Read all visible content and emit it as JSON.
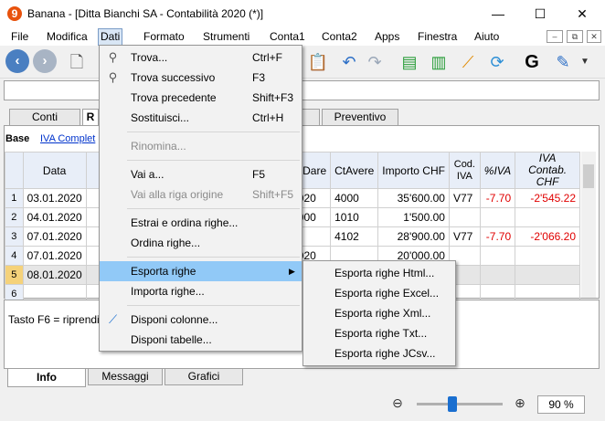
{
  "window": {
    "title": "Banana - [Ditta Bianchi SA - Contabilità 2020 (*)]",
    "minimize": "—",
    "maximize": "☐",
    "close": "✕"
  },
  "menubar": {
    "items": [
      "File",
      "Modifica",
      "Dati",
      "Formato",
      "Strumenti",
      "Conta1",
      "Conta2",
      "Apps",
      "Finestra",
      "Aiuto"
    ],
    "mdi_min": "–",
    "mdi_restore": "⧉",
    "mdi_close": "✕"
  },
  "tabs": {
    "conti": "Conti",
    "registrazioni": "R",
    "preventivo": "Preventivo"
  },
  "view": {
    "base_label": "Base",
    "base_link": "IVA Complet"
  },
  "grid": {
    "headers": [
      "Data",
      "D",
      "CtDare",
      "CtAvere",
      "Importo CHF",
      "Cod. IVA",
      "%IVA",
      "IVA Contab. CHF"
    ],
    "rows": [
      {
        "n": "1",
        "data": "03.01.2020",
        "ctdare": "1020",
        "ctavere": "4000",
        "importo": "35'600.00",
        "cod": "V77",
        "pct": "-7.70",
        "iva": "-2'545.22"
      },
      {
        "n": "2",
        "data": "04.01.2020",
        "ctdare": "1000",
        "ctavere": "1010",
        "importo": "1'500.00",
        "cod": "",
        "pct": "",
        "iva": ""
      },
      {
        "n": "3",
        "data": "07.01.2020",
        "ctdare": "",
        "ctavere": "4102",
        "importo": "28'900.00",
        "cod": "V77",
        "pct": "-7.70",
        "iva": "-2'066.20"
      },
      {
        "n": "4",
        "data": "07.01.2020",
        "ctdare": "1020",
        "ctavere": "",
        "importo": "20'000.00",
        "cod": "",
        "pct": "",
        "iva": ""
      },
      {
        "n": "5",
        "data": "08.01.2020",
        "ctdare": "",
        "ctavere": "",
        "importo": "",
        "cod": "",
        "pct": "",
        "iva": ""
      },
      {
        "n": "6",
        "data": "",
        "ctdare": "",
        "ctavere": "",
        "importo": "",
        "cod": "",
        "pct": "",
        "iva": ""
      }
    ]
  },
  "message": {
    "text": "Tasto F6 = riprendi v"
  },
  "bottom_tabs": [
    "Info",
    "Messaggi",
    "Grafici"
  ],
  "status": {
    "zoom": "90 %"
  },
  "dati_menu": {
    "trova": {
      "label": "Trova...",
      "shortcut": "Ctrl+F"
    },
    "trova_successivo": {
      "label": "Trova successivo",
      "shortcut": "F3"
    },
    "trova_precedente": {
      "label": "Trova precedente",
      "shortcut": "Shift+F3"
    },
    "sostituisci": {
      "label": "Sostituisci...",
      "shortcut": "Ctrl+H"
    },
    "rinomina": {
      "label": "Rinomina..."
    },
    "vai_a": {
      "label": "Vai a...",
      "shortcut": "F5"
    },
    "vai_origine": {
      "label": "Vai alla riga origine",
      "shortcut": "Shift+F5"
    },
    "estrai": {
      "label": "Estrai e ordina righe..."
    },
    "ordina": {
      "label": "Ordina righe..."
    },
    "esporta": {
      "label": "Esporta righe"
    },
    "importa": {
      "label": "Importa righe..."
    },
    "disponi_colonne": {
      "label": "Disponi colonne..."
    },
    "disponi_tabelle": {
      "label": "Disponi tabelle..."
    }
  },
  "esporta_submenu": [
    "Esporta righe Html...",
    "Esporta righe Excel...",
    "Esporta righe Xml...",
    "Esporta righe Txt...",
    "Esporta righe JCsv..."
  ],
  "colors": {
    "accent": "#91c9f7",
    "negative": "#e00000",
    "selected_row_marker": "#f5d27a"
  }
}
